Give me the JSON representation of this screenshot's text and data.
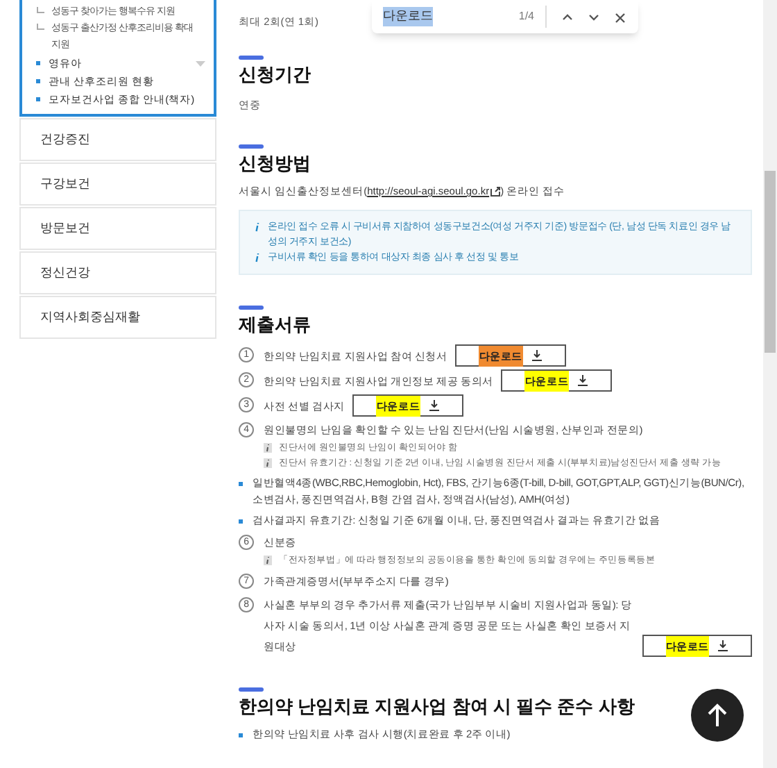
{
  "sidebar": {
    "sub_items": [
      "성동구 찾아가는 행복수유 지원",
      "성동구 출산가정 산후조리비용 확대지원"
    ],
    "items": [
      {
        "label": "영유아",
        "has_submenu": true
      },
      {
        "label": "관내 산후조리원 현황",
        "has_submenu": false
      },
      {
        "label": "모자보건사업 종합 안내(책자)",
        "has_submenu": false
      }
    ],
    "menus": [
      "건강증진",
      "구강보건",
      "방문보건",
      "정신건강",
      "지역사회중심재활"
    ]
  },
  "find_bar": {
    "query": "다운로드",
    "count": "1/4"
  },
  "intro": "최대 2회(연 1회)",
  "sections": [
    {
      "title": "신청기간",
      "paragraph": "연중"
    },
    {
      "title": "신청방법",
      "paragraph_before": "서울시 임신출산정보센터(",
      "link": "http://seoul-agi.seoul.go.kr",
      "paragraph_after": ") 온라인 접수",
      "notes": [
        "온라인 접수 오류 시 구비서류 지참하여 성동구보건소(여성 거주지 기준) 방문접수 (단, 남성 단독 치료인 경우 남성의 거주지 보건소)",
        "구비서류 확인 등을 통하여 대상자 최종 심사 후 선정 및 통보"
      ]
    },
    {
      "title": "제출서류",
      "items": [
        {
          "kind": "numbered",
          "number": "1",
          "text": "한의약 난임치료 지원사업 참여 신청서",
          "download": {
            "label": "다운로드",
            "current_match": true
          }
        },
        {
          "kind": "numbered",
          "number": "2",
          "text": "한의약 난임치료 지원사업 개인정보 제공 동의서",
          "download": {
            "label": "다운로드",
            "current_match": false
          }
        },
        {
          "kind": "numbered",
          "number": "3",
          "text": "사전 선별 검사지",
          "download": {
            "label": "다운로드",
            "current_match": false
          }
        },
        {
          "kind": "numbered",
          "number": "4",
          "text": "원인불명의 난임을 확인할 수 있는 난임 진단서(난임 시술병원, 산부인과 전문의)",
          "notes": [
            "진단서에 원인불명의 난임이 확인되어야 함",
            "진단서 유효기간 : 신청일 기준 2년 이내, 난임 시술병원 진단서 제출 시(부부치료)남성진단서 제출 생략 가능"
          ]
        },
        {
          "kind": "bullet",
          "text": "일반혈액4종(WBC,RBC,Hemoglobin, Hct), FBS, 간기능6종(T-bill, D-bill, GOT,GPT,ALP, GGT)신기능(BUN/Cr), 소변검사, 풍진면역검사, B형 간염 검사, 정액검사(남성), AMH(여성)"
        },
        {
          "kind": "bullet",
          "text": "검사결과지 유효기간: 신청일 기준 6개월 이내, 단, 풍진면역검사 결과는 유효기간 없음"
        },
        {
          "kind": "numbered",
          "number": "6",
          "text": "신분증",
          "notes": [
            "「전자정부법」에 따라 행정정보의 공동이용을 통한 확인에 동의할 경우에는 주민등록등본"
          ]
        },
        {
          "kind": "numbered",
          "number": "7",
          "text": "가족관계증명서(부부주소지 다를 경우)"
        },
        {
          "kind": "numbered",
          "number": "8",
          "text": "사실혼 부부의 경우 추가서류 제출(국가 난임부부 시술비 지원사업과 동일): 당사자 시술 동의서, 1년 이상 사실혼 관계 증명 공문 또는 사실혼 확인 보증서 지원대상",
          "download": {
            "label": "다운로드",
            "current_match": false
          }
        }
      ]
    },
    {
      "title": "한의약 난임치료 지원사업 참여 시 필수 준수 사항",
      "items": [
        {
          "kind": "bullet",
          "text": "한의약 난임치료 사후 검사 시행(치료완료 후 2주 이내)"
        }
      ]
    }
  ]
}
